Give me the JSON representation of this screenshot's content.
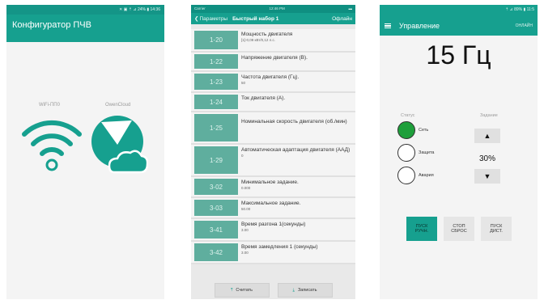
{
  "screen1": {
    "status_text": "✕ ▣ ⇡ ⊿ 24% ▮ 14:36",
    "title": "Конфигуратор ПЧВ",
    "wifi_label": "WiFi-ПП0",
    "cloud_label": "OwenCloud",
    "accent": "#16a08f"
  },
  "screen2": {
    "status_carrier": "Carrier",
    "status_time": "12:46 PM",
    "back_label": "Параметры",
    "title": "Быстрый набор 1",
    "mode": "Офлайн",
    "params": [
      {
        "code": "1-20",
        "name": "Мощность двигателя",
        "value": "[1]-0,09 кВт/0,12 л.с."
      },
      {
        "code": "1-22",
        "name": "Напряжение двигателя (В).",
        "value": ""
      },
      {
        "code": "1-23",
        "name": "Частота двигателя (Гц).",
        "value": "50"
      },
      {
        "code": "1-24",
        "name": "Ток двигателя (А).",
        "value": ""
      },
      {
        "code": "1-25",
        "name": "Номинальная скорость двигателя (об./мин)",
        "value": ""
      },
      {
        "code": "1-29",
        "name": "Автоматическая адаптация двигателя (ААД)",
        "value": "0"
      },
      {
        "code": "3-02",
        "name": "Минимальное задание.",
        "value": "0.000"
      },
      {
        "code": "3-03",
        "name": "Максимальное задание.",
        "value": "50.00"
      },
      {
        "code": "3-41",
        "name": "Время разгона 1(секунды)",
        "value": "3.00"
      },
      {
        "code": "3-42",
        "name": "Время замедления 1 (секунды)",
        "value": "3.00"
      }
    ],
    "read_button": "Считать",
    "write_button": "Записать"
  },
  "screen3": {
    "status_text": "⇡ ⊿ 89% ▮ 11:5",
    "title": "Управление",
    "mode": "ОНЛАЙН",
    "frequency": "15 Гц",
    "status_header": "Статус",
    "task_header": "Задание",
    "status_items": [
      {
        "label": "Сеть",
        "active": true
      },
      {
        "label": "Защита",
        "active": false
      },
      {
        "label": "Авария",
        "active": false
      }
    ],
    "percent": "30%",
    "buttons": [
      {
        "line1": "ПУСК",
        "line2": "РУЧН."
      },
      {
        "line1": "СТОП",
        "line2": "СБРОС"
      },
      {
        "line1": "ПУСК",
        "line2": "ДИСТ."
      }
    ]
  }
}
